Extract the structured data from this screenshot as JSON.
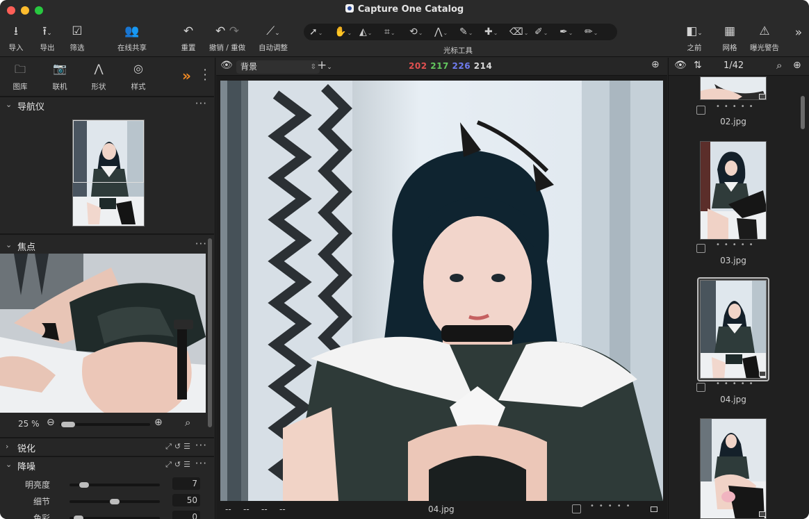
{
  "window": {
    "title": "Capture One Catalog"
  },
  "toolbar": {
    "import": "导入",
    "export": "导出",
    "filter": "筛选",
    "share": "在线共享",
    "reset": "重置",
    "undo_redo": "撤销 / 重做",
    "auto_adjust": "自动调整",
    "cursor_tools": "光标工具",
    "before": "之前",
    "grid": "网格",
    "exposure_warning": "曝光警告"
  },
  "left_tabs": {
    "library": "图库",
    "tether": "联机",
    "shape": "形状",
    "style": "样式"
  },
  "navigator": {
    "title": "导航仪"
  },
  "focus": {
    "title": "焦点",
    "zoom": "25 %"
  },
  "sharpen": {
    "title": "锐化"
  },
  "noise": {
    "title": "降噪",
    "rows": [
      {
        "label": "明亮度",
        "value": "7",
        "level": 0.12
      },
      {
        "label": "细节",
        "value": "50",
        "level": 0.5
      },
      {
        "label": "色彩",
        "value": "0",
        "level": 0.05
      }
    ]
  },
  "viewer": {
    "layer": "背景",
    "rgb": {
      "r": "202",
      "g": "217",
      "b": "226",
      "l": "214"
    },
    "foot_left": [
      "--",
      "--",
      "--",
      "--"
    ],
    "filename": "04.jpg"
  },
  "browser": {
    "count": "1/42",
    "thumbs": [
      {
        "name": "02.jpg"
      },
      {
        "name": "03.jpg"
      },
      {
        "name": "04.jpg",
        "selected": true
      }
    ]
  },
  "colors": {
    "red": "#e05050",
    "green": "#63c75f",
    "blue": "#6f7cf0",
    "accent": "#f08a24"
  }
}
